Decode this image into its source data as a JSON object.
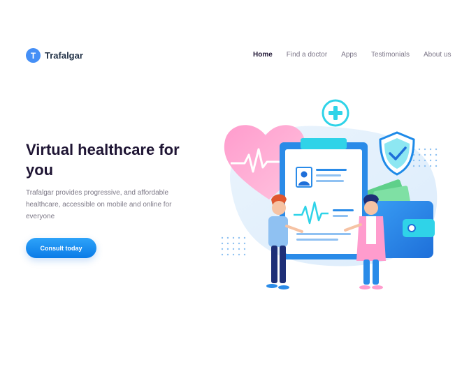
{
  "brand": {
    "mark": "T",
    "name": "Trafalgar"
  },
  "nav": {
    "items": [
      {
        "label": "Home",
        "active": true
      },
      {
        "label": "Find a doctor",
        "active": false
      },
      {
        "label": "Apps",
        "active": false
      },
      {
        "label": "Testimonials",
        "active": false
      },
      {
        "label": "About us",
        "active": false
      }
    ]
  },
  "hero": {
    "title": "Virtual healthcare for you",
    "description": "Trafalgar provides progressive, and affordable healthcare, accessible on mobile and online for everyone",
    "cta_label": "Consult today"
  },
  "colors": {
    "primary": "#458ff6",
    "heading": "#1f1534",
    "body_text": "#7d7987",
    "heart": "#ff8fc4",
    "accent_teal": "#2fd3e8"
  },
  "illustration": {
    "icons": [
      "heart-icon",
      "plus-icon",
      "shield-check-icon",
      "clipboard-icon",
      "wallet-icon",
      "doctor-figure",
      "patient-figure"
    ]
  }
}
